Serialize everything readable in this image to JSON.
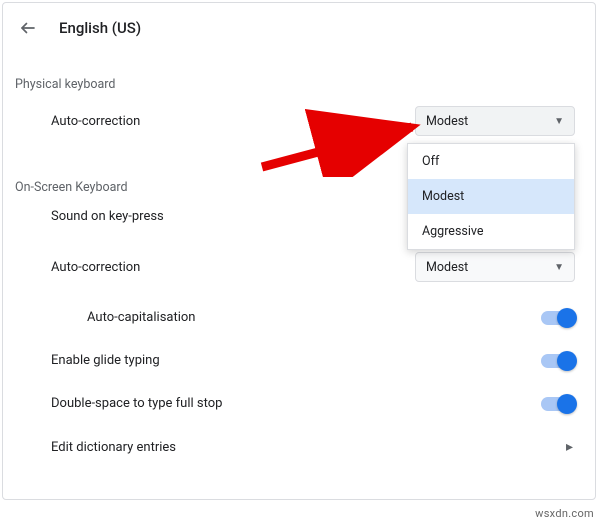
{
  "header": {
    "title": "English (US)"
  },
  "sections": {
    "physical": {
      "title": "Physical keyboard"
    },
    "onscreen": {
      "title": "On-Screen Keyboard"
    }
  },
  "rows": {
    "physical_autocorrect": {
      "label": "Auto-correction",
      "value": "Modest"
    },
    "sound": {
      "label": "Sound on key-press"
    },
    "onscreen_autocorrect": {
      "label": "Auto-correction",
      "value": "Modest"
    },
    "autocap": {
      "label": "Auto-capitalisation"
    },
    "glide": {
      "label": "Enable glide typing"
    },
    "doublespace": {
      "label": "Double-space to type full stop"
    },
    "dictionary": {
      "label": "Edit dictionary entries"
    }
  },
  "dropdown": {
    "options": [
      "Off",
      "Modest",
      "Aggressive"
    ],
    "selected": "Modest"
  },
  "watermark": "wsxdn.com"
}
